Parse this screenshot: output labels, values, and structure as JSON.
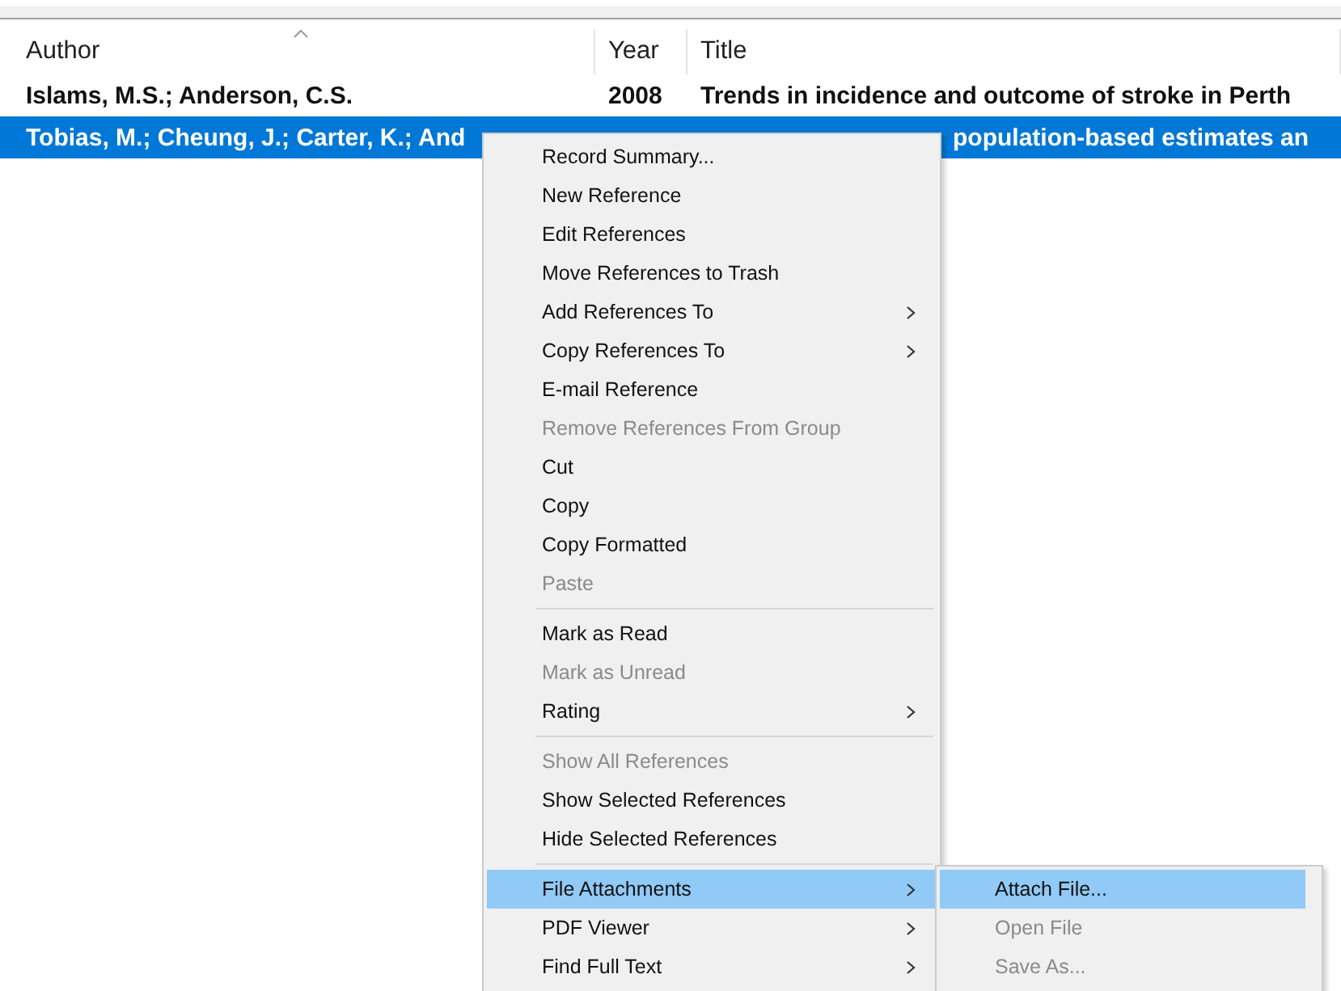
{
  "table": {
    "columns": [
      {
        "label": "Author",
        "sorted": true
      },
      {
        "label": "Year",
        "sorted": false
      },
      {
        "label": "Title",
        "sorted": false
      }
    ],
    "rows": [
      {
        "author": "Islams, M.S.; Anderson, C.S.",
        "year": "2008",
        "title": "Trends in incidence and outcome of stroke in Perth",
        "selected": false
      },
      {
        "author": "Tobias, M.; Cheung, J.; Carter, K.; And",
        "title": "population-based estimates an",
        "selected": true
      }
    ]
  },
  "context_menu": {
    "items": [
      {
        "kind": "item",
        "label": "Record Summary...",
        "disabled": false,
        "has_submenu": false,
        "selected": false
      },
      {
        "kind": "item",
        "label": "New Reference",
        "disabled": false,
        "has_submenu": false,
        "selected": false
      },
      {
        "kind": "item",
        "label": "Edit References",
        "disabled": false,
        "has_submenu": false,
        "selected": false
      },
      {
        "kind": "item",
        "label": "Move References to Trash",
        "disabled": false,
        "has_submenu": false,
        "selected": false
      },
      {
        "kind": "item",
        "label": "Add References To",
        "disabled": false,
        "has_submenu": true,
        "selected": false
      },
      {
        "kind": "item",
        "label": "Copy References To",
        "disabled": false,
        "has_submenu": true,
        "selected": false
      },
      {
        "kind": "item",
        "label": "E-mail Reference",
        "disabled": false,
        "has_submenu": false,
        "selected": false
      },
      {
        "kind": "item",
        "label": "Remove References From Group",
        "disabled": true,
        "has_submenu": false,
        "selected": false
      },
      {
        "kind": "item",
        "label": "Cut",
        "disabled": false,
        "has_submenu": false,
        "selected": false
      },
      {
        "kind": "item",
        "label": "Copy",
        "disabled": false,
        "has_submenu": false,
        "selected": false
      },
      {
        "kind": "item",
        "label": "Copy Formatted",
        "disabled": false,
        "has_submenu": false,
        "selected": false
      },
      {
        "kind": "item",
        "label": "Paste",
        "disabled": true,
        "has_submenu": false,
        "selected": false
      },
      {
        "kind": "separator"
      },
      {
        "kind": "item",
        "label": "Mark as Read",
        "disabled": false,
        "has_submenu": false,
        "selected": false
      },
      {
        "kind": "item",
        "label": "Mark as Unread",
        "disabled": true,
        "has_submenu": false,
        "selected": false
      },
      {
        "kind": "item",
        "label": "Rating",
        "disabled": false,
        "has_submenu": true,
        "selected": false
      },
      {
        "kind": "separator"
      },
      {
        "kind": "item",
        "label": "Show All References",
        "disabled": true,
        "has_submenu": false,
        "selected": false
      },
      {
        "kind": "item",
        "label": "Show Selected References",
        "disabled": false,
        "has_submenu": false,
        "selected": false
      },
      {
        "kind": "item",
        "label": "Hide Selected References",
        "disabled": false,
        "has_submenu": false,
        "selected": false
      },
      {
        "kind": "separator"
      },
      {
        "kind": "item",
        "label": "File Attachments",
        "disabled": false,
        "has_submenu": true,
        "selected": true,
        "submenu": [
          {
            "label": "Attach File...",
            "disabled": false,
            "selected": true
          },
          {
            "label": "Open File",
            "disabled": true,
            "selected": false
          },
          {
            "label": "Save As...",
            "disabled": true,
            "selected": false
          }
        ]
      },
      {
        "kind": "item",
        "label": "PDF Viewer",
        "disabled": false,
        "has_submenu": true,
        "selected": false
      },
      {
        "kind": "item",
        "label": "Find Full Text",
        "disabled": false,
        "has_submenu": true,
        "selected": false
      }
    ]
  }
}
